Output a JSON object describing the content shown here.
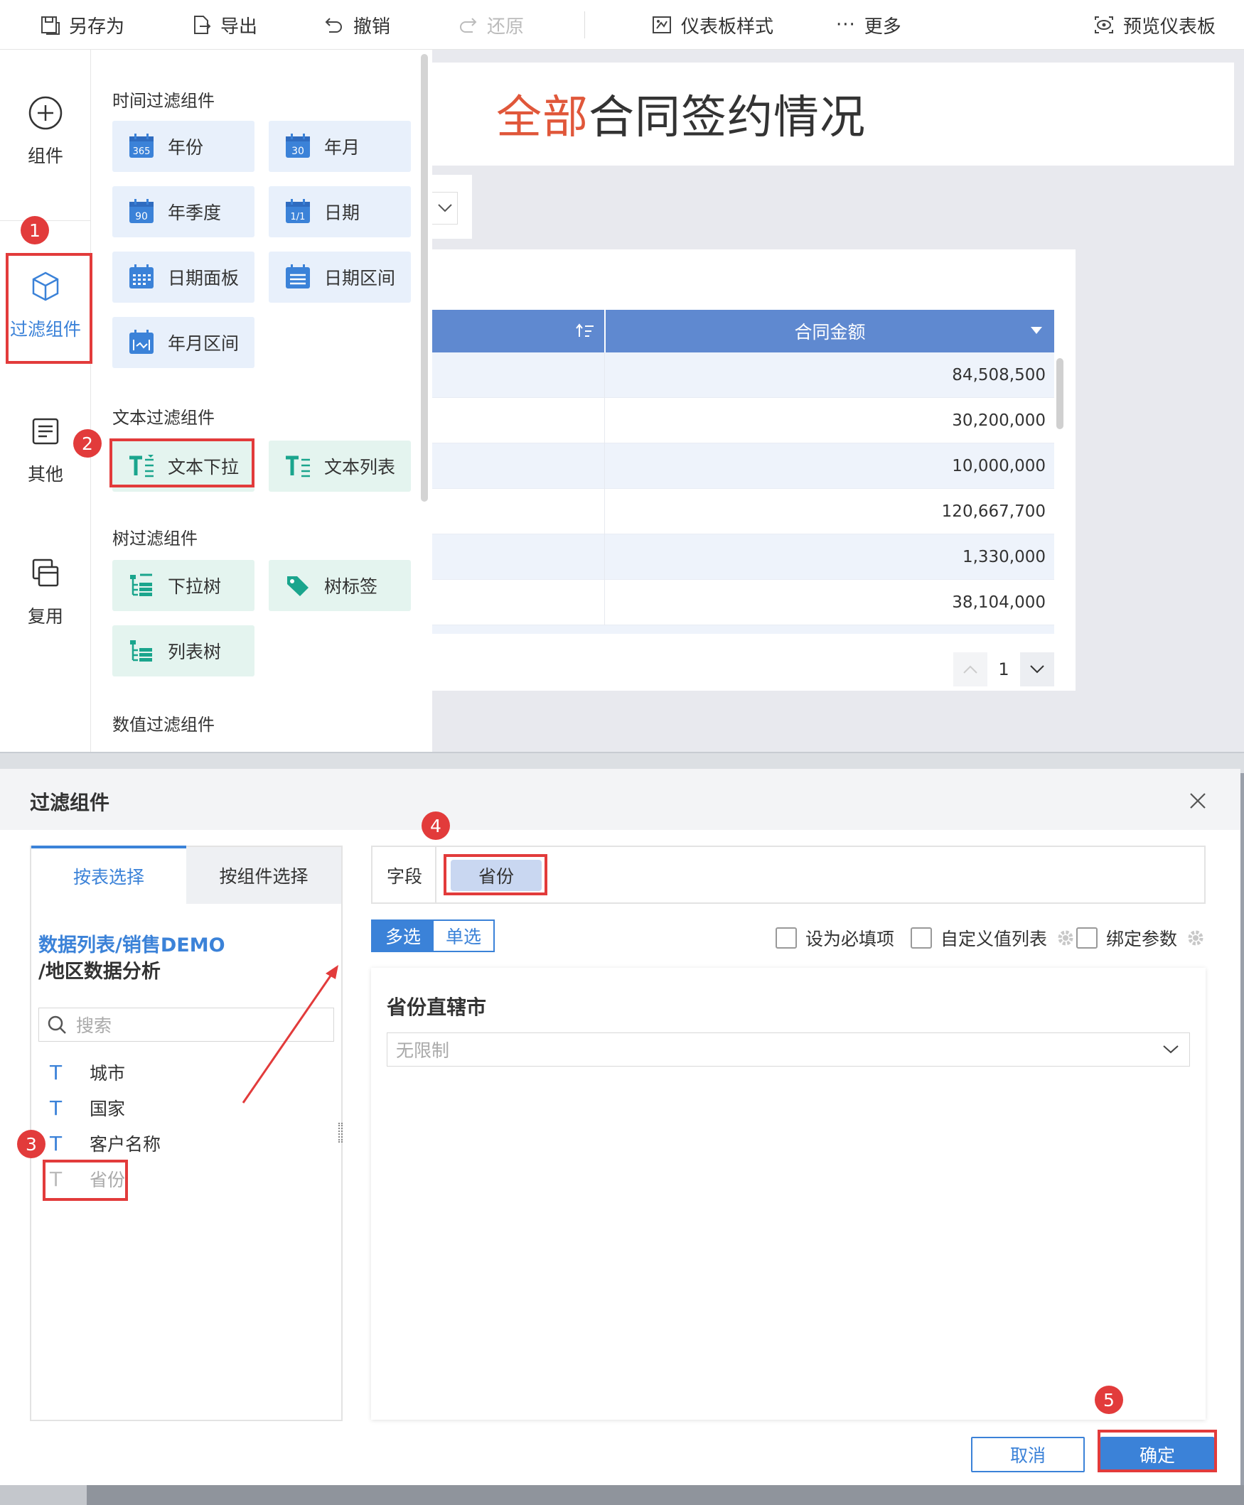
{
  "toolbar": {
    "save_as": "另存为",
    "export": "导出",
    "undo": "撤销",
    "redo": "还原",
    "dashboard_style": "仪表板样式",
    "more": "更多",
    "preview": "预览仪表板"
  },
  "leftnav": {
    "components": "组件",
    "filter_components": "过滤组件",
    "other": "其他",
    "reuse": "复用"
  },
  "panel": {
    "time_section": "时间过滤组件",
    "time_items": [
      "年份",
      "年月",
      "年季度",
      "日期",
      "日期面板",
      "日期区间",
      "年月区间"
    ],
    "time_icon_nums": [
      "365",
      "30",
      "90",
      "1/1"
    ],
    "text_section": "文本过滤组件",
    "text_items": [
      "文本下拉",
      "文本列表"
    ],
    "tree_section": "树过滤组件",
    "tree_items": [
      "下拉树",
      "树标签",
      "列表树"
    ],
    "numeric_section": "数值过滤组件"
  },
  "dashboard": {
    "title_highlight": "全部",
    "title_rest": "合同签约情况",
    "table_header": "合同金额",
    "rows": [
      "84,508,500",
      "30,200,000",
      "10,000,000",
      "120,667,700",
      "1,330,000",
      "38,104,000"
    ],
    "page": "1"
  },
  "badges": [
    "1",
    "2",
    "3",
    "4",
    "5"
  ],
  "dialog": {
    "title": "过滤组件",
    "tab_by_table": "按表选择",
    "tab_by_component": "按组件选择",
    "dataset_path_1": "数据列表/销售DEMO",
    "dataset_path_2": "/地区数据分析",
    "search_placeholder": "搜索",
    "fields": [
      "城市",
      "国家",
      "客户名称",
      "省份"
    ],
    "field_type_glyph": "T",
    "field_label": "字段",
    "selected_field": "省份",
    "multi_select": "多选",
    "single_select": "单选",
    "required": "设为必填项",
    "custom_values": "自定义值列表",
    "bind_param": "绑定参数",
    "control_title": "省份直辖市",
    "control_value": "无限制",
    "cancel": "取消",
    "confirm": "确定"
  },
  "colors": {
    "accent": "#3b82d8",
    "header_blue": "#5f89d0",
    "title_red": "#e0573a",
    "annotation_red": "#e23b3b"
  }
}
